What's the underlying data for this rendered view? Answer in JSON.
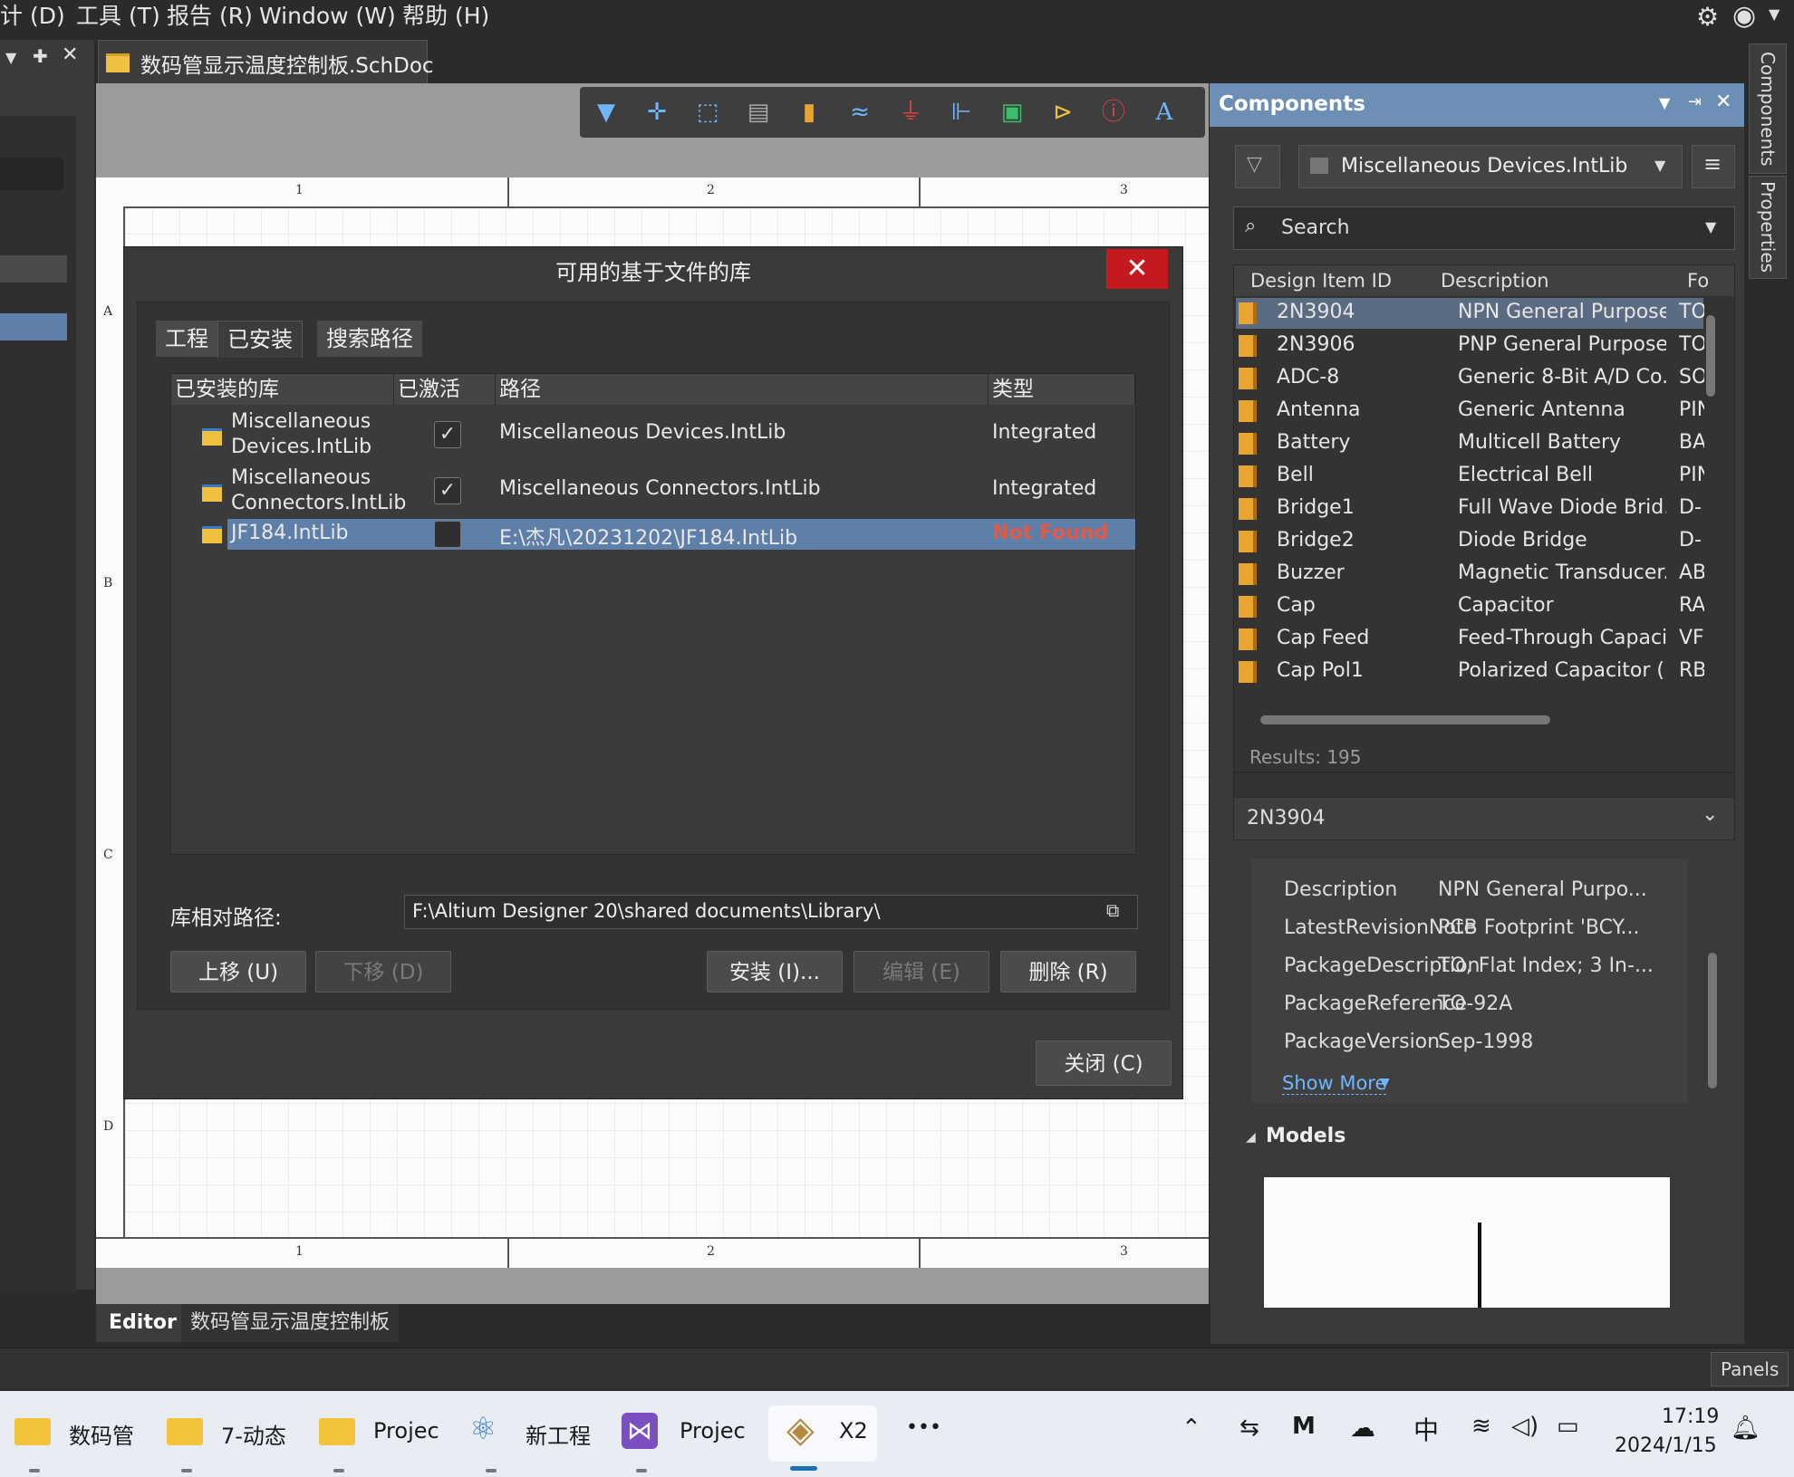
{
  "menubar": {
    "items": [
      "计 (D)",
      "工具 (T)",
      "报告 (R)",
      "Window (W)",
      "帮助 (H)"
    ]
  },
  "document_tab": {
    "label": "数码管显示温度控制板.SchDoc"
  },
  "sheet": {
    "col_labels": [
      "1",
      "2",
      "3"
    ],
    "row_labels": [
      "A",
      "B",
      "C",
      "D"
    ]
  },
  "dialog": {
    "title": "可用的基于文件的库",
    "close_glyph": "✕",
    "tabs": [
      "工程",
      "已安装",
      "搜索路径"
    ],
    "table": {
      "headers": [
        "已安装的库",
        "已激活",
        "路径",
        "类型"
      ],
      "rows": [
        {
          "name_line1": "Miscellaneous",
          "name_line2": "Devices.IntLib",
          "active": "✓",
          "path": "Miscellaneous Devices.IntLib",
          "type": "Integrated"
        },
        {
          "name_line1": "Miscellaneous",
          "name_line2": "Connectors.IntLib",
          "active": "✓",
          "path": "Miscellaneous Connectors.IntLib",
          "type": "Integrated"
        },
        {
          "name_line1": "JF184.IntLib",
          "name_line2": "",
          "active": "",
          "path": "E:\\杰凡\\20231202\\JF184.IntLib",
          "type": "Not Found"
        }
      ]
    },
    "relative_path_label": "库相对路径:",
    "relative_path_value": "F:\\Altium Designer 20\\shared documents\\Library\\",
    "buttons": {
      "move_up": "上移 (U)",
      "move_down": "下移 (D)",
      "install": "安装 (I)...",
      "edit": "编辑 (E)",
      "remove": "删除 (R)",
      "close": "关闭 (C)"
    }
  },
  "components_panel": {
    "title": "Components",
    "library": "Miscellaneous Devices.IntLib",
    "search_placeholder": "Search",
    "columns": [
      "Design Item ID",
      "Description",
      "Fo"
    ],
    "rows": [
      {
        "id": "2N3904",
        "desc": "NPN General Purpose...",
        "fp": "TO"
      },
      {
        "id": "2N3906",
        "desc": "PNP General Purpose...",
        "fp": "TO"
      },
      {
        "id": "ADC-8",
        "desc": "Generic 8-Bit A/D Co...",
        "fp": "SO"
      },
      {
        "id": "Antenna",
        "desc": "Generic Antenna",
        "fp": "PIN"
      },
      {
        "id": "Battery",
        "desc": "Multicell Battery",
        "fp": "BA"
      },
      {
        "id": "Bell",
        "desc": "Electrical Bell",
        "fp": "PIN"
      },
      {
        "id": "Bridge1",
        "desc": "Full Wave Diode Brid...",
        "fp": "D-"
      },
      {
        "id": "Bridge2",
        "desc": "Diode Bridge",
        "fp": "D-"
      },
      {
        "id": "Buzzer",
        "desc": "Magnetic Transducer...",
        "fp": "AB"
      },
      {
        "id": "Cap",
        "desc": "Capacitor",
        "fp": "RA"
      },
      {
        "id": "Cap Feed",
        "desc": "Feed-Through Capaci...",
        "fp": "VF"
      },
      {
        "id": "Cap Pol1",
        "desc": "Polarized Capacitor (...",
        "fp": "RB"
      }
    ],
    "results": "Results: 195",
    "selected": "2N3904",
    "properties": [
      {
        "k": "Description",
        "v": "NPN General Purpo..."
      },
      {
        "k": "LatestRevisionNote",
        "v": "PCB Footprint 'BCY..."
      },
      {
        "k": "PackageDescription",
        "v": "TO, Flat Index; 3 In-..."
      },
      {
        "k": "PackageReference",
        "v": "TO-92A"
      },
      {
        "k": "PackageVersion",
        "v": "Sep-1998"
      }
    ],
    "show_more": "Show More",
    "models_label": "Models"
  },
  "right_strip": {
    "tabs": [
      "Components",
      "Properties"
    ]
  },
  "bottom_tabs": [
    "Editor",
    "数码管显示温度控制板"
  ],
  "status_bar": {
    "panels": "Panels"
  },
  "taskbar": {
    "apps": [
      {
        "label": "数码管"
      },
      {
        "label": "7-动态"
      },
      {
        "label": "Projec"
      },
      {
        "label": "新工程"
      },
      {
        "label": "Projec"
      },
      {
        "label": "X2"
      }
    ],
    "more": "•••",
    "ime": "中",
    "time": "17:19",
    "date": "2024/1/15"
  },
  "colors": {
    "accent_header": "#6d8fb6",
    "selected_row": "#5e7fa8",
    "not_found": "#e05a4a",
    "close_red": "#c4191e"
  }
}
